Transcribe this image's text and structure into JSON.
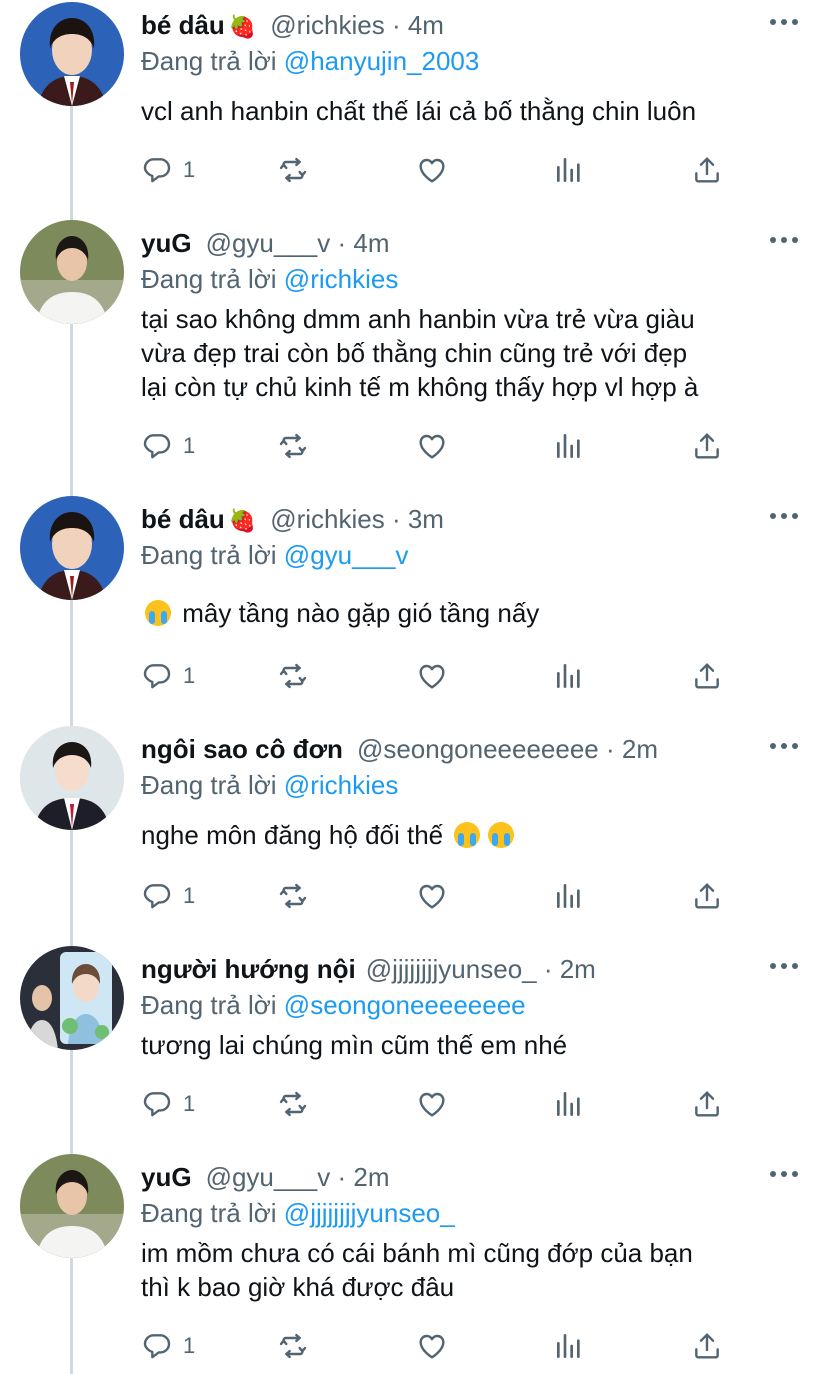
{
  "accent_color": "#1d9bf0",
  "secondary_text_color": "#536471",
  "reply_prefix": "Đang trả lời",
  "tweets": [
    {
      "name": "bé dâu",
      "name_emoji": "🍓",
      "handle": "@richkies",
      "time": "· 4m",
      "reply_to": "@hanyujin_2003",
      "text_lines": [
        "vcl anh hanbin chất thế lái cả bố thằng chin luôn"
      ],
      "reply_count": "1"
    },
    {
      "name": "yuG",
      "handle": "@gyu___v",
      "time": "· 4m",
      "reply_to": "@richkies",
      "text_lines": [
        "tại sao không dmm anh hanbin vừa trẻ vừa giàu",
        "vừa đẹp trai còn bố thằng chin cũng trẻ với đẹp",
        "lại còn tự chủ kinh tế m không thấy hợp vl hợp à"
      ],
      "reply_count": "1"
    },
    {
      "name": "bé dâu",
      "name_emoji": "🍓",
      "handle": "@richkies",
      "time": "· 3m",
      "reply_to": "@gyu___v",
      "text_lines": [
        "mây tầng nào gặp gió tầng nấy"
      ],
      "reply_count": "1"
    },
    {
      "name": "ngôi sao cô đơn",
      "handle": "@seongoneeeeeeee",
      "time": "· 2m",
      "reply_to": "@richkies",
      "text_lines": [
        "nghe môn đăng hộ đối thế"
      ],
      "reply_count": "1"
    },
    {
      "name": "người hướng nội",
      "handle": "@jjjjjjjjyunseo_",
      "time": "· 2m",
      "reply_to": "@seongoneeeeeeee",
      "text_lines": [
        "tương lai chúng mìn cũm thế em nhé"
      ],
      "reply_count": "1"
    },
    {
      "name": "yuG",
      "handle": "@gyu___v",
      "time": "· 2m",
      "reply_to": "@jjjjjjjjyunseo_",
      "text_lines": [
        "im mồm chưa có cái bánh mì cũng đớp của bạn",
        "thì k bao giờ khá được đâu"
      ],
      "reply_count": "1"
    }
  ],
  "icons": {
    "reply": "reply-icon",
    "retweet": "retweet-icon",
    "like": "heart-icon",
    "analytics": "analytics-icon",
    "share": "share-icon",
    "more": "more-icon"
  }
}
